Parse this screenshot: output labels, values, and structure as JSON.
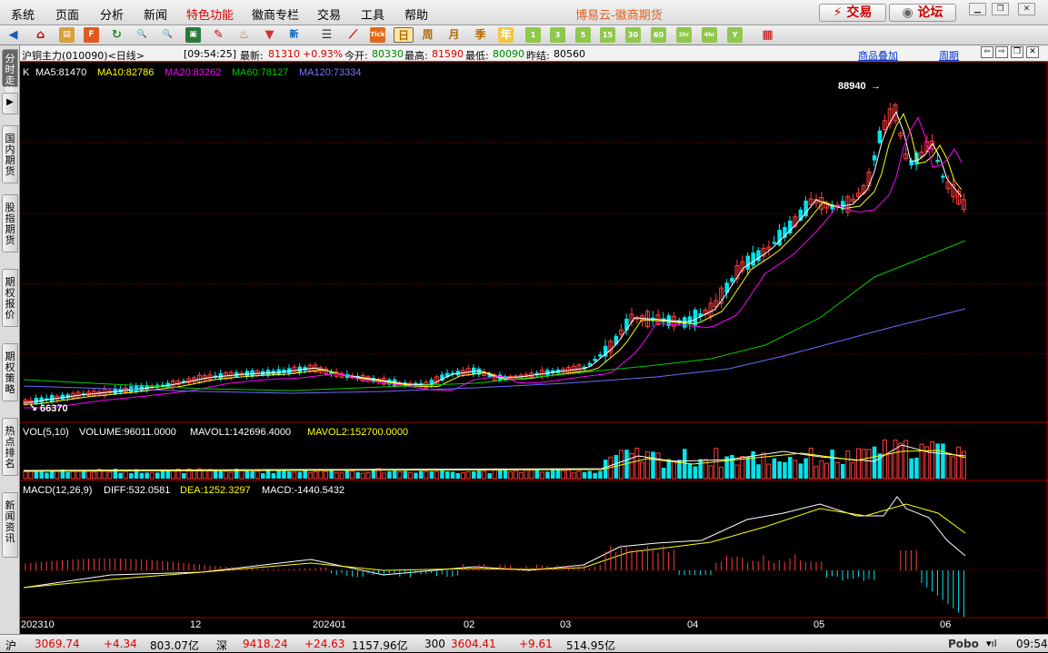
{
  "menu": {
    "items": [
      "系统",
      "页面",
      "分析",
      "新闻",
      "特色功能",
      "徽商专栏",
      "交易",
      "工具",
      "帮助"
    ],
    "app_title": "博易云-徽商期货",
    "trade_button": "交易",
    "forum_button": "论坛"
  },
  "toolbar": {
    "period_buttons": [
      "日",
      "周",
      "月",
      "季",
      "年",
      "1",
      "3",
      "5",
      "15",
      "30",
      "60",
      "2hr",
      "4hr",
      "Y"
    ]
  },
  "sidebar": {
    "tabs": [
      "分时走势",
      "K线",
      "国内期货",
      "股指期货",
      "期权报价",
      "期权策略",
      "热点排名",
      "新闻资讯"
    ]
  },
  "info": {
    "contract": "沪铜主力(010090)<日线>",
    "time": "[09:54:25]",
    "latest_label": "最新:",
    "latest": "81310",
    "change": "+0.93%",
    "open_label": "今开:",
    "open": "80330",
    "high_label": "最高:",
    "high": "81590",
    "low_label": "最低:",
    "low": "80090",
    "prev_label": "昨结:",
    "prev": "80560",
    "overlay_link": "商品叠加",
    "period_link": "周期"
  },
  "ma": {
    "k": "K",
    "ma5": "MA5:81470",
    "ma10": "MA10:82786",
    "ma20": "MA20:83262",
    "ma60": "MA60:78127",
    "ma120": "MA120:73334"
  },
  "vol": {
    "label": "VOL(5,10)",
    "volume": "VOLUME:96011.0000",
    "mavol1": "MAVOL1:142696.4000",
    "mavol2": "MAVOL2:152700.0000"
  },
  "macd": {
    "label": "MACD(12,26,9)",
    "diff": "DIFF:532.0581",
    "dea": "DEA:1252.3297",
    "macd": "MACD:-1440.5432"
  },
  "x_axis": {
    "labels": [
      "202310",
      "12",
      "202401",
      "02",
      "03",
      "04",
      "05",
      "06"
    ]
  },
  "annotations": {
    "high_price": "88940",
    "low_price": "66370"
  },
  "colors": {
    "up": "#ff3c3c",
    "down": "#00e5ee",
    "ma5": "#ffffff",
    "ma10": "#ffff00",
    "ma20": "#ff00ff",
    "ma60": "#00cc00",
    "ma120": "#6a6aff"
  },
  "status": {
    "sh_label": "沪",
    "sh_value": "3069.74",
    "sh_change": "+4.34",
    "sh_amount": "803.07亿",
    "sz_label": "深",
    "sz_value": "9418.24",
    "sz_change": "+24.63",
    "sz_amount": "1157.96亿",
    "c300_label": "300",
    "c300_value": "3604.41",
    "c300_change": "+9.61",
    "c300_amount": "514.95亿",
    "brand": "Pobo",
    "clock": "09:54"
  }
}
